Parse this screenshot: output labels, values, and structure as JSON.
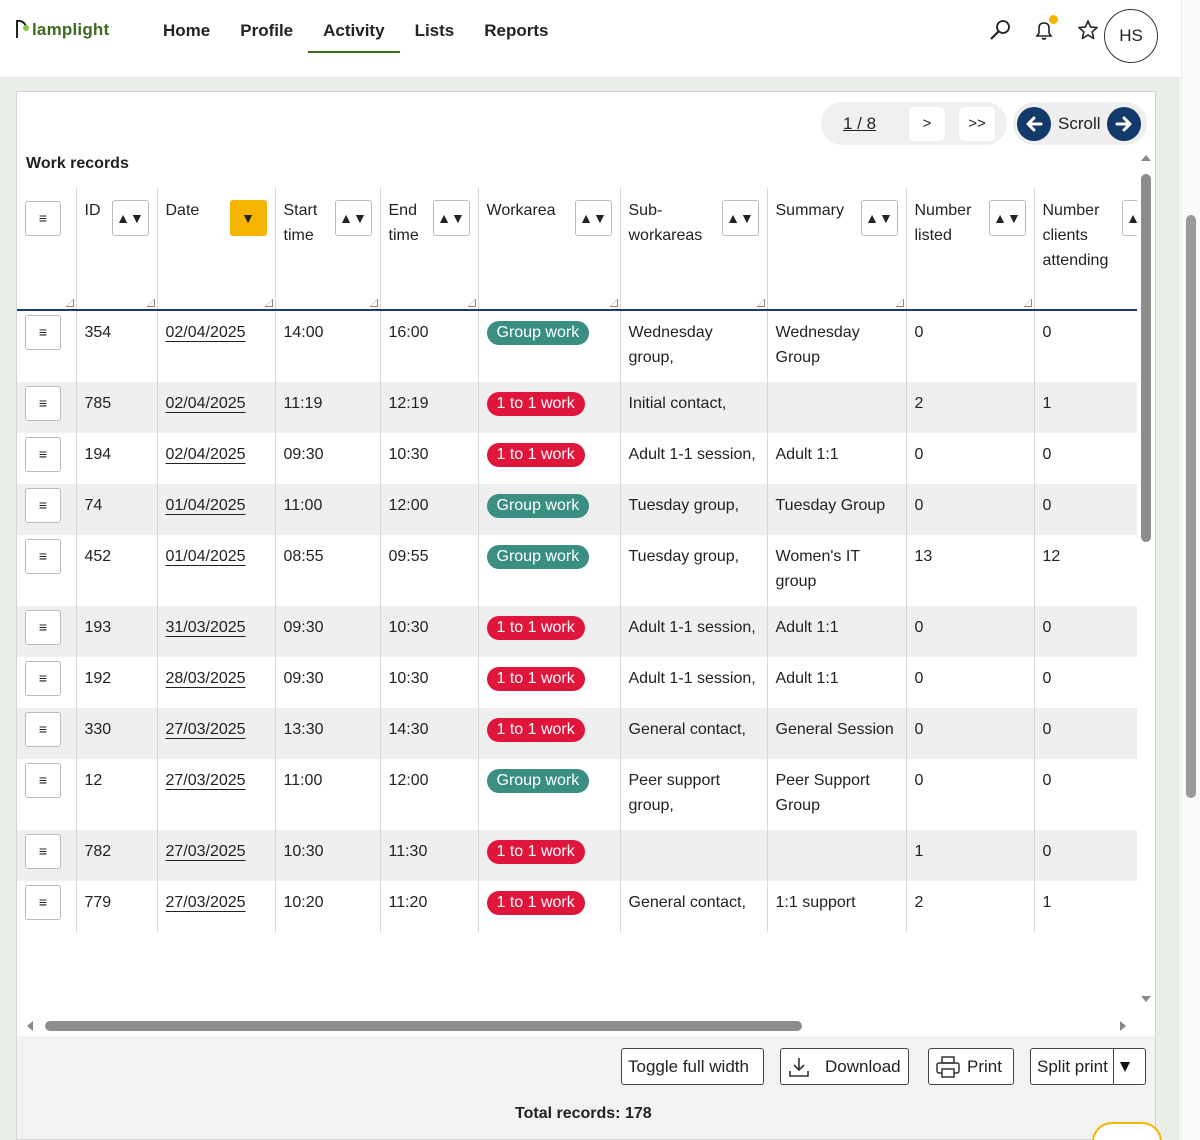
{
  "logo": {
    "text": "lamplight"
  },
  "nav": [
    {
      "label": "Home"
    },
    {
      "label": "Profile"
    },
    {
      "label": "Activity",
      "active": true
    },
    {
      "label": "Lists"
    },
    {
      "label": "Reports"
    }
  ],
  "header_icons": [
    "search-icon",
    "bell-icon",
    "star-icon"
  ],
  "user": {
    "initials": "HS"
  },
  "pager": {
    "count": "1 / 8",
    "next": ">",
    "last": ">>"
  },
  "scroll": {
    "label": "Scroll"
  },
  "section_title": "Work records",
  "columns": [
    {
      "label": "",
      "sortable": false
    },
    {
      "label": "ID"
    },
    {
      "label": "Date",
      "active": true
    },
    {
      "label": "Start time"
    },
    {
      "label": "End time"
    },
    {
      "label": "Workarea"
    },
    {
      "label": "Sub-workareas"
    },
    {
      "label": "Summary"
    },
    {
      "label": "Number listed"
    },
    {
      "label": "Number clients attending"
    }
  ],
  "rows": [
    {
      "id": "354",
      "date": "02/04/2025",
      "start": "14:00",
      "end": "16:00",
      "workarea": "Group work",
      "sub": "Wednesday group,",
      "summary": "Wednesday Group",
      "listed": "0",
      "attending": "0"
    },
    {
      "id": "785",
      "date": "02/04/2025",
      "start": "11:19",
      "end": "12:19",
      "workarea": "1 to 1 work",
      "sub": "Initial contact,",
      "summary": "",
      "listed": "2",
      "attending": "1"
    },
    {
      "id": "194",
      "date": "02/04/2025",
      "start": "09:30",
      "end": "10:30",
      "workarea": "1 to 1 work",
      "sub": "Adult 1-1 session,",
      "summary": "Adult 1:1",
      "listed": "0",
      "attending": "0"
    },
    {
      "id": "74",
      "date": "01/04/2025",
      "start": "11:00",
      "end": "12:00",
      "workarea": "Group work",
      "sub": "Tuesday group,",
      "summary": "Tuesday Group",
      "listed": "0",
      "attending": "0"
    },
    {
      "id": "452",
      "date": "01/04/2025",
      "start": "08:55",
      "end": "09:55",
      "workarea": "Group work",
      "sub": "Tuesday group,",
      "summary": "Women's IT group",
      "listed": "13",
      "attending": "12"
    },
    {
      "id": "193",
      "date": "31/03/2025",
      "start": "09:30",
      "end": "10:30",
      "workarea": "1 to 1 work",
      "sub": "Adult 1-1 session,",
      "summary": "Adult 1:1",
      "listed": "0",
      "attending": "0"
    },
    {
      "id": "192",
      "date": "28/03/2025",
      "start": "09:30",
      "end": "10:30",
      "workarea": "1 to 1 work",
      "sub": "Adult 1-1 session,",
      "summary": "Adult 1:1",
      "listed": "0",
      "attending": "0"
    },
    {
      "id": "330",
      "date": "27/03/2025",
      "start": "13:30",
      "end": "14:30",
      "workarea": "1 to 1 work",
      "sub": "General contact,",
      "summary": "General Session",
      "listed": "0",
      "attending": "0"
    },
    {
      "id": "12",
      "date": "27/03/2025",
      "start": "11:00",
      "end": "12:00",
      "workarea": "Group work",
      "sub": "Peer support group,",
      "summary": "Peer Support Group",
      "listed": "0",
      "attending": "0"
    },
    {
      "id": "782",
      "date": "27/03/2025",
      "start": "10:30",
      "end": "11:30",
      "workarea": "1 to 1 work",
      "sub": "",
      "summary": "",
      "listed": "1",
      "attending": "0"
    },
    {
      "id": "779",
      "date": "27/03/2025",
      "start": "10:20",
      "end": "11:20",
      "workarea": "1 to 1 work",
      "sub": "General contact,",
      "summary": "1:1 support",
      "listed": "2",
      "attending": "1"
    }
  ],
  "badge_colors": {
    "Group work": "#3a8f82",
    "1 to 1 work": "#e0153c"
  },
  "colors": {
    "brand": "#3d6b1f",
    "accent": "#f5b400",
    "nav_blue": "#133a6b"
  },
  "footer": {
    "toggle_label": "Toggle full width",
    "download_label": "Download",
    "print_label": "Print",
    "split_print_label": "Split print",
    "total_label": "Total records: 178"
  }
}
